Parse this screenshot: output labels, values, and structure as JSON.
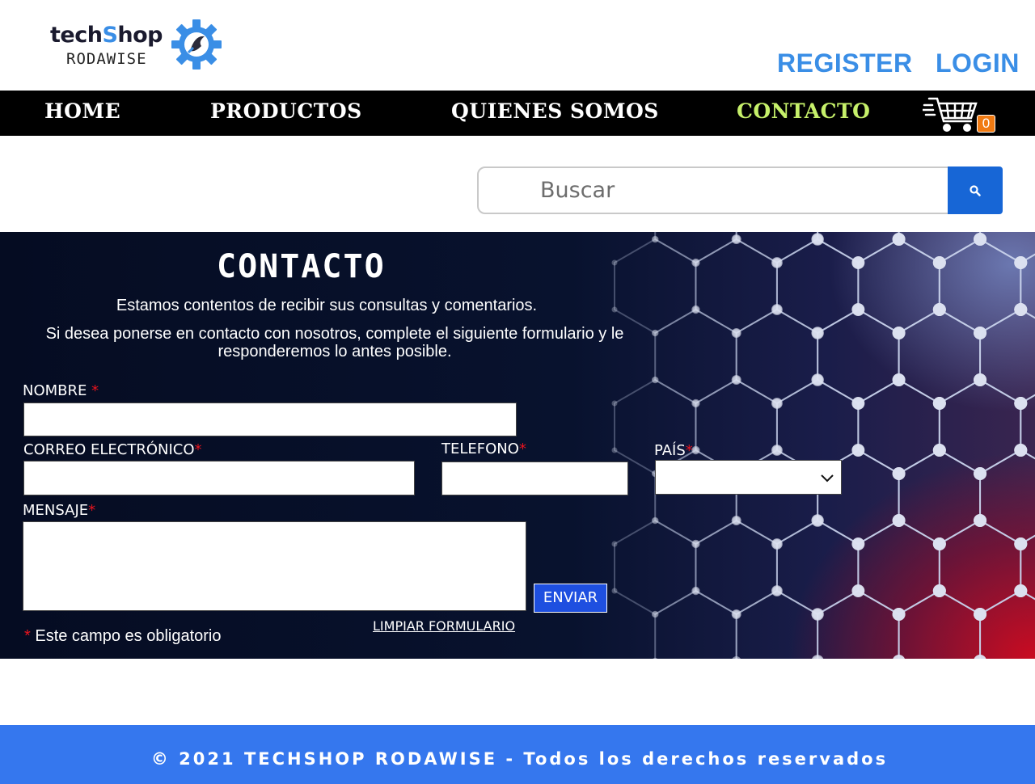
{
  "brand": {
    "line1_a": "tech",
    "line1_b": "S",
    "line1_c": "hop",
    "line2": "RODAWISE"
  },
  "header": {
    "register_label": "REGISTER",
    "login_label": "LOGIN"
  },
  "nav": {
    "items": [
      {
        "label": "HOME"
      },
      {
        "label": "PRODUCTOS"
      },
      {
        "label": "QUIENES SOMOS"
      },
      {
        "label": "CONTACTO"
      }
    ],
    "active": "CONTACTO",
    "cart_count": "0"
  },
  "search": {
    "placeholder": "Buscar",
    "value": ""
  },
  "contact": {
    "title": "CONTACTO",
    "intro_line1": "Estamos contentos de recibir sus consultas y comentarios.",
    "intro_line2": "Si desea ponerse en contacto con nosotros, complete el siguiente formulario y le responderemos lo antes posible.",
    "fields": {
      "nombre": {
        "label": "NOMBRE ",
        "value": ""
      },
      "correo": {
        "label": "CORREO ELECTRÓNICO",
        "value": ""
      },
      "telefono": {
        "label": "TELEFONO",
        "value": ""
      },
      "pais": {
        "label": "PAÍS",
        "value": ""
      },
      "mensaje": {
        "label": "MENSAJE",
        "value": ""
      }
    },
    "required_mark": "*",
    "submit_label": "ENVIAR",
    "clear_label": "LIMPIAR FORMULARIO",
    "required_note": " Este campo es obligatorio"
  },
  "footer": {
    "text": "© 2021 TECHSHOP RODAWISE - Todos los derechos reservados"
  },
  "icons": {
    "logo_gear": "gear-icon",
    "cart": "shopping-cart-icon",
    "search": "search-icon",
    "select": "chevron-down-icon"
  },
  "colors": {
    "accent_blue": "#3a8ee6",
    "nav_bg": "#000000",
    "nav_active": "#c6f06a",
    "search_button": "#1766d6",
    "cart_badge": "#f07a12",
    "required": "#e8141e",
    "submit": "#1e4fe0",
    "footer_bg": "#3577ee"
  }
}
